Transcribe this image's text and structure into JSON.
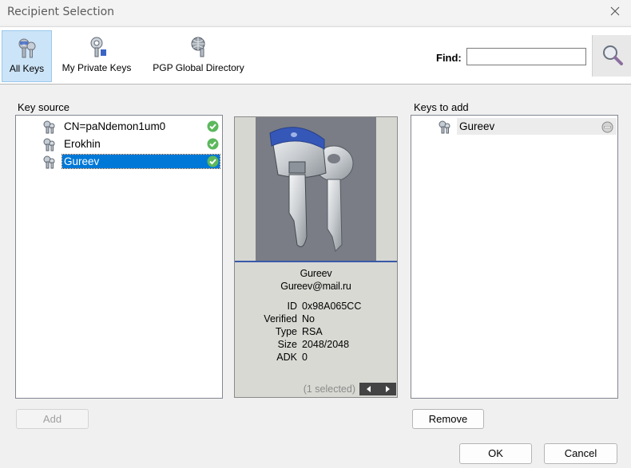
{
  "window": {
    "title": "Recipient Selection"
  },
  "toolbar": {
    "all_keys": "All Keys",
    "my_private_keys": "My Private Keys",
    "pgp_global_directory": "PGP Global Directory",
    "find_label": "Find:",
    "find_value": ""
  },
  "key_source": {
    "label": "Key source",
    "items": [
      {
        "name": "CN=paNdemon1um0",
        "icon": "key-icon",
        "status": "valid-check-icon"
      },
      {
        "name": "Erokhin",
        "icon": "key-icon",
        "status": "valid-check-icon"
      },
      {
        "name": "Gureev",
        "icon": "key-icon",
        "status": "valid-check-icon",
        "selected": true
      }
    ]
  },
  "details": {
    "name": "Gureev",
    "email": "Gureev@mail.ru",
    "fields": [
      {
        "key": "ID",
        "value": "0x98A065CC"
      },
      {
        "key": "Verified",
        "value": "No"
      },
      {
        "key": "Type",
        "value": "RSA"
      },
      {
        "key": "Size",
        "value": "2048/2048"
      },
      {
        "key": "ADK",
        "value": "0"
      }
    ],
    "selection_count": "(1 selected)"
  },
  "keys_to_add": {
    "label": "Keys to add",
    "items": [
      {
        "name": "Gureev",
        "icon": "key-icon",
        "action": "remove-circle-icon"
      }
    ]
  },
  "buttons": {
    "add": "Add",
    "remove": "Remove",
    "ok": "OK",
    "cancel": "Cancel"
  },
  "colors": {
    "selection": "#0078d7",
    "check_green": "#5cb85c",
    "toolbar_active": "#cce4f7"
  }
}
